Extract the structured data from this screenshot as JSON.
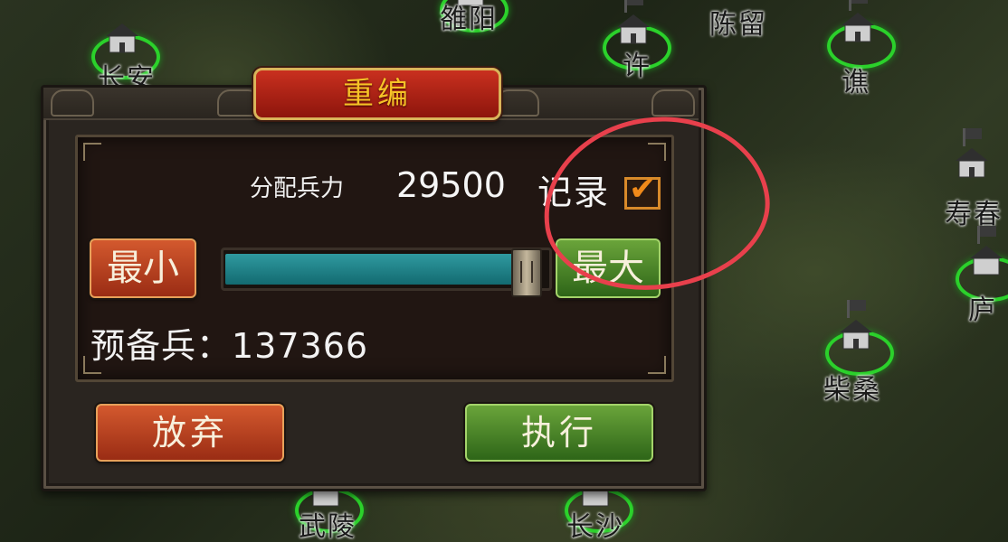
{
  "map": {
    "cities": [
      {
        "name": "长安"
      },
      {
        "name": "雒阳"
      },
      {
        "name": "许"
      },
      {
        "name": "陈留"
      },
      {
        "name": "谯"
      },
      {
        "name": "寿春"
      },
      {
        "name": "庐"
      },
      {
        "name": "柴桑"
      },
      {
        "name": "武陵"
      },
      {
        "name": "长沙"
      }
    ]
  },
  "dialog": {
    "title": "重编",
    "alloc_label": "分配兵力",
    "alloc_value": "29500",
    "record_label": "记录",
    "record_checked": true,
    "record_check_glyph": "✔",
    "min_label": "最小",
    "max_label": "最大",
    "slider_fraction": 0.95,
    "reserve_text": "预备兵：137366",
    "abandon_label": "放弃",
    "execute_label": "执行"
  },
  "colors": {
    "annotation": "#e8404c",
    "accent_gold": "#f6c227",
    "city_ring": "#2bd12b"
  }
}
